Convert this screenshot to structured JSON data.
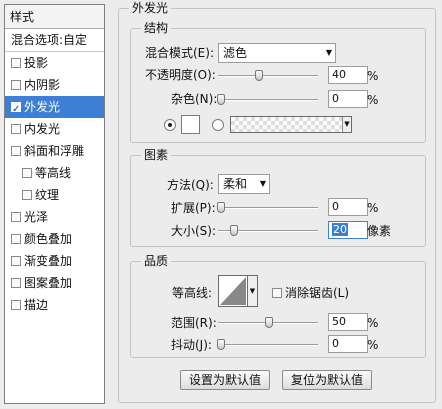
{
  "left": {
    "header": "样式",
    "blend_options": "混合选项:自定",
    "items": [
      {
        "label": "投影",
        "checked": false
      },
      {
        "label": "内阴影",
        "checked": false
      },
      {
        "label": "外发光",
        "checked": true
      },
      {
        "label": "内发光",
        "checked": false
      },
      {
        "label": "斜面和浮雕",
        "checked": false
      },
      {
        "label": "等高线",
        "checked": false
      },
      {
        "label": "纹理",
        "checked": false
      },
      {
        "label": "光泽",
        "checked": false
      },
      {
        "label": "颜色叠加",
        "checked": false
      },
      {
        "label": "渐变叠加",
        "checked": false
      },
      {
        "label": "图案叠加",
        "checked": false
      },
      {
        "label": "描边",
        "checked": false
      }
    ]
  },
  "panel": {
    "title": "外发光",
    "structure": {
      "title": "结构",
      "blend_mode_label": "混合模式(E):",
      "blend_mode_value": "滤色",
      "opacity_label": "不透明度(O):",
      "opacity_value": "40",
      "noise_label": "杂色(N):",
      "noise_value": "0",
      "unit": "%"
    },
    "elements": {
      "title": "图素",
      "method_label": "方法(Q):",
      "method_value": "柔和",
      "spread_label": "扩展(P):",
      "spread_value": "0",
      "size_label": "大小(S):",
      "size_value": "20",
      "size_unit": "像素",
      "unit": "%"
    },
    "quality": {
      "title": "品质",
      "contour_label": "等高线:",
      "antialias_label": "消除锯齿(L)",
      "range_label": "范围(R):",
      "range_value": "50",
      "jitter_label": "抖动(J):",
      "jitter_value": "0",
      "unit": "%"
    },
    "buttons": {
      "set_default": "设置为默认值",
      "reset_default": "复位为默认值"
    }
  }
}
